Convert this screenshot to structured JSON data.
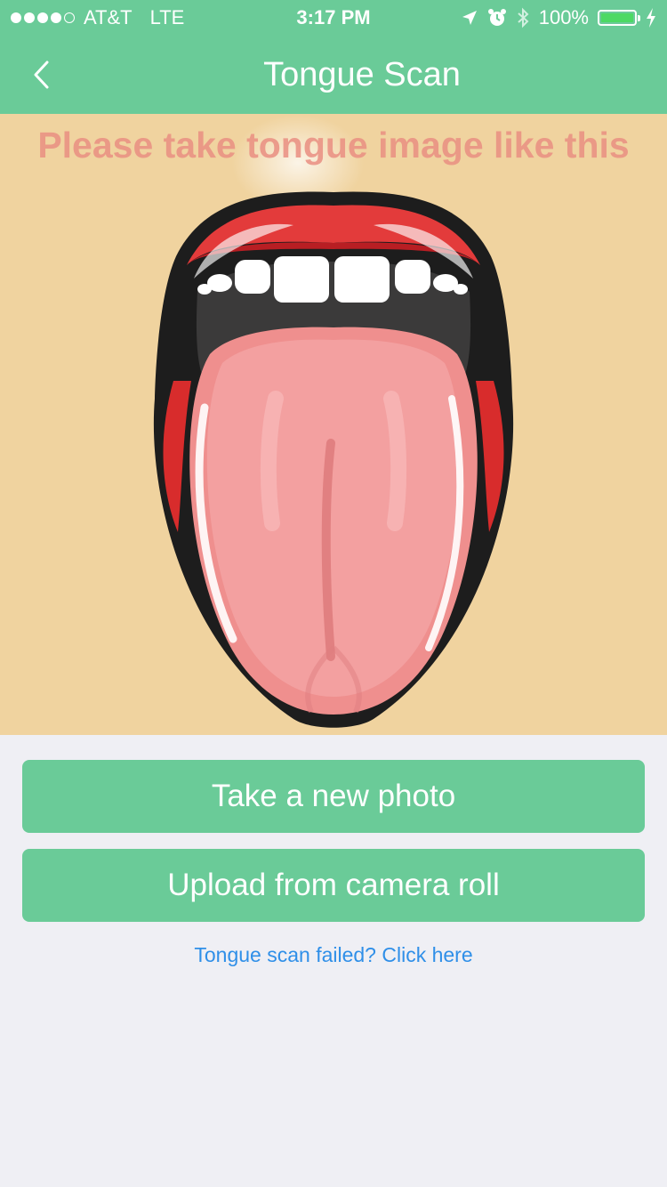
{
  "status_bar": {
    "carrier": "AT&T",
    "network": "LTE",
    "time": "3:17 PM",
    "battery_percent": "100%",
    "signal_bars_filled": 4,
    "signal_bars_total": 5,
    "battery_fill_color": "#4cd964"
  },
  "nav": {
    "back_icon": "chevron-left-icon",
    "title": "Tongue Scan",
    "background_color": "#6acb98"
  },
  "illustration": {
    "caption": "Please take tongue image like this",
    "background_color": "#f0d39f"
  },
  "actions": {
    "take_photo_label": "Take a new photo",
    "upload_label": "Upload from camera roll",
    "help_link": "Tongue scan failed? Click here"
  },
  "colors": {
    "accent": "#6acb98",
    "link": "#2f8fe8",
    "page_background": "#efeff4"
  }
}
